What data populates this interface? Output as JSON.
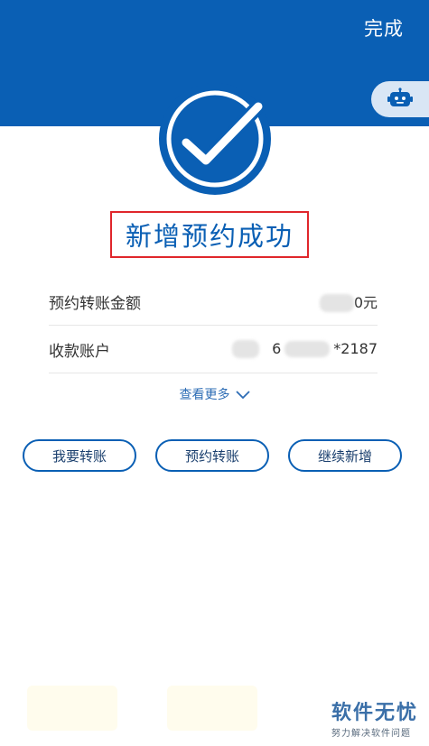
{
  "header": {
    "done_label": "完成",
    "brand_color": "#0a5fb4"
  },
  "assistant": {
    "icon": "robot-icon"
  },
  "result": {
    "icon": "checkmark-circle-icon",
    "title": "新增预约成功"
  },
  "details": {
    "rows": [
      {
        "label": "预约转账金额",
        "value_visible": "0元"
      },
      {
        "label": "收款账户",
        "value_prefix": "6",
        "value_suffix": "*2187"
      }
    ],
    "more_label": "查看更多"
  },
  "actions": {
    "transfer_label": "我要转账",
    "scheduled_transfer_label": "预约转账",
    "continue_add_label": "继续新增"
  },
  "watermark": {
    "main": "软件无忧",
    "sub": "努力解决软件问题"
  }
}
